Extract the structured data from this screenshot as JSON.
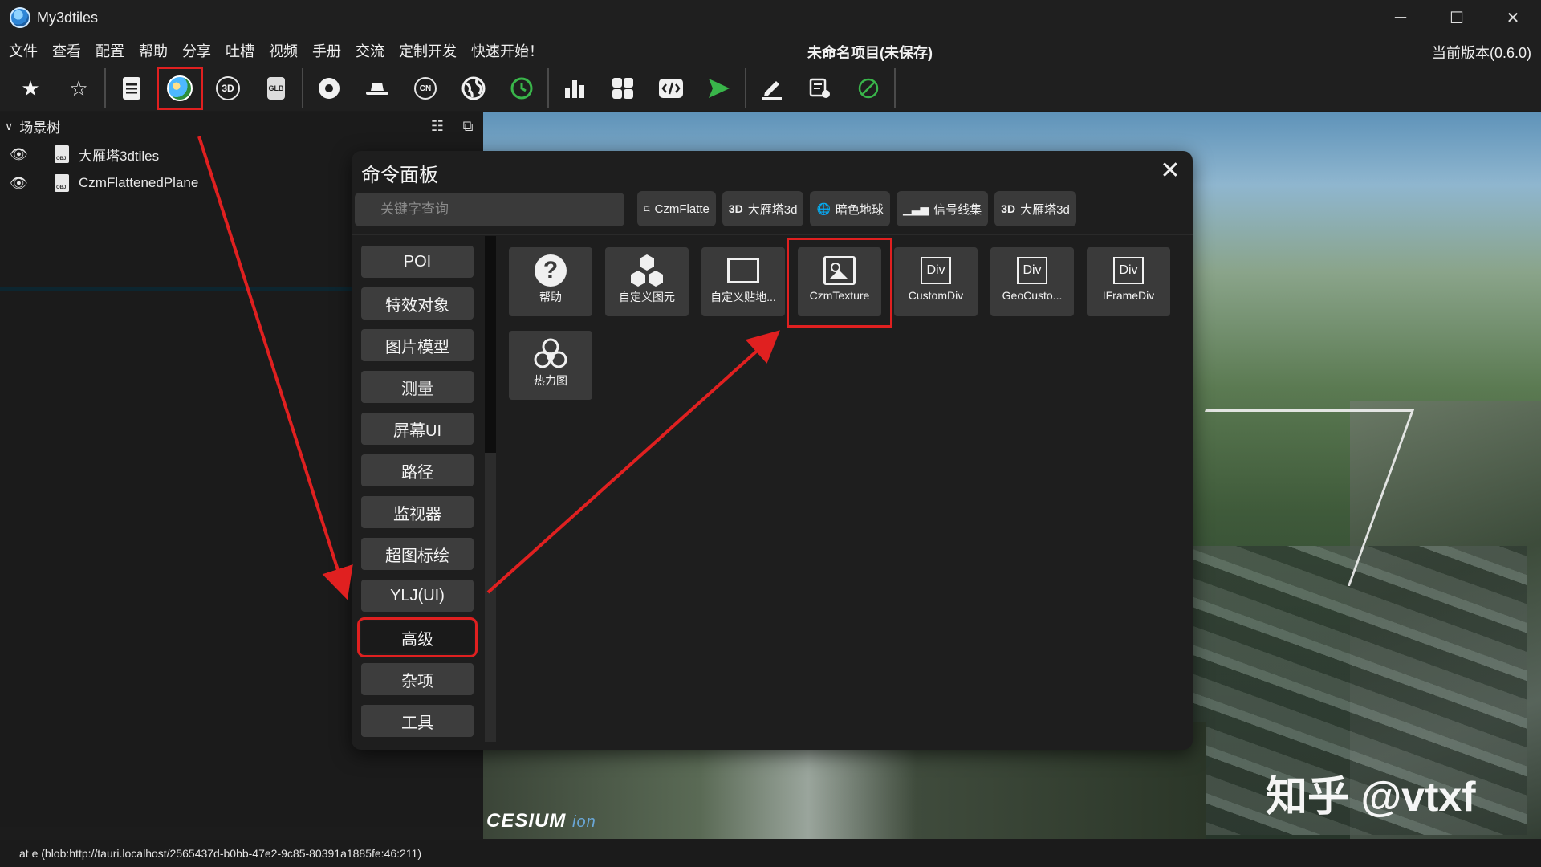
{
  "app": {
    "title": "My3dtiles"
  },
  "menu": {
    "items": [
      "文件",
      "查看",
      "配置",
      "帮助",
      "分享",
      "吐槽",
      "视频",
      "手册",
      "交流",
      "定制开发",
      "快速开始！"
    ],
    "project_title": "未命名项目(未保存)",
    "version": "当前版本(0.6.0)"
  },
  "toolbar": {
    "icons": [
      "star-filled",
      "star-outline",
      "document",
      "scene-image",
      "3d-model",
      "glb",
      "target",
      "hat",
      "cn-map",
      "globe",
      "clock",
      "bar-chart",
      "grid-blocks",
      "code",
      "play",
      "pen",
      "form-settings",
      "ban"
    ],
    "labels": {
      "3d": "3D",
      "glb": "GLB",
      "cn": "CN"
    }
  },
  "scene_tree": {
    "title": "场景树",
    "items": [
      {
        "label": "大雁塔3dtiles"
      },
      {
        "label": "CzmFlattenedPlane"
      }
    ]
  },
  "command_panel": {
    "title": "命令面板",
    "search_placeholder": "关键字查询",
    "recent": [
      {
        "icon": "⌑",
        "label": "CzmFlatte"
      },
      {
        "icon": "3D",
        "label": "大雁塔3d"
      },
      {
        "icon": "🌐",
        "label": "暗色地球"
      },
      {
        "icon": "▁▃▅",
        "label": "信号线集"
      },
      {
        "icon": "3D",
        "label": "大雁塔3d"
      }
    ],
    "categories": [
      "POI",
      "特效对象",
      "图片模型",
      "测量",
      "屏幕UI",
      "路径",
      "监视器",
      "超图标绘",
      "YLJ(UI)",
      "高级",
      "杂项",
      "工具"
    ],
    "active_category": "高级",
    "tiles": [
      {
        "label": "帮助",
        "icon": "help-icon"
      },
      {
        "label": "自定义图元",
        "icon": "cubes-icon"
      },
      {
        "label": "自定义贴地...",
        "icon": "rectangle-icon"
      },
      {
        "label": "CzmTexture",
        "icon": "image-icon"
      },
      {
        "label": "CustomDiv",
        "icon": "div-icon"
      },
      {
        "label": "GeoCusto...",
        "icon": "div-icon"
      },
      {
        "label": "IFrameDiv",
        "icon": "div-icon"
      },
      {
        "label": "热力图",
        "icon": "heatmap-icon"
      }
    ],
    "div_text": "Div",
    "help_text": "?",
    "highlighted_tile": "CzmTexture"
  },
  "viewport": {
    "attribution": "CESIUM",
    "attribution_suffix": "ion",
    "watermark": "知乎 @vtxf"
  },
  "status": {
    "text": "at e (blob:http://tauri.localhost/2565437d-b0bb-47e2-9c85-80391a1885fe:46:211)"
  },
  "colors": {
    "highlight": "#e02020",
    "play": "#39b54a",
    "clock": "#39b54a"
  }
}
